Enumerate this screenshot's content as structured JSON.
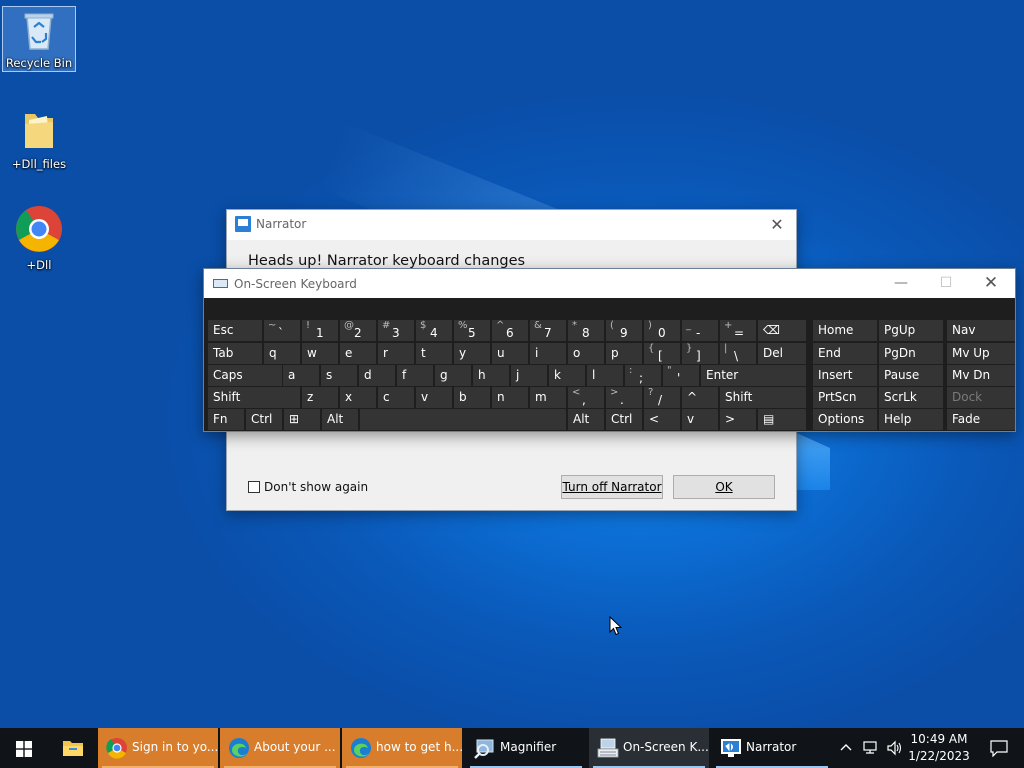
{
  "desktop": {
    "icons": [
      {
        "label": "Recycle Bin"
      },
      {
        "label": "+Dll_files"
      },
      {
        "label": "+Dll"
      }
    ]
  },
  "narrator": {
    "title": "Narrator",
    "close_glyph": "✕",
    "heading": "Heads up! Narrator keyboard changes",
    "checkbox_label": "Don't show again",
    "turn_off_label": "Turn off Narrator",
    "ok_label": "OK"
  },
  "osk": {
    "title": "On-Screen Keyboard",
    "minimize_glyph": "—",
    "maximize_glyph": "☐",
    "close_glyph": "✕",
    "rows": [
      [
        {
          "m": "Esc"
        },
        {
          "s": "~",
          "b": "`"
        },
        {
          "s": "!",
          "b": "1"
        },
        {
          "s": "@",
          "b": "2"
        },
        {
          "s": "#",
          "b": "3"
        },
        {
          "s": "$",
          "b": "4"
        },
        {
          "s": "%",
          "b": "5"
        },
        {
          "s": "^",
          "b": "6"
        },
        {
          "s": "&",
          "b": "7"
        },
        {
          "s": "*",
          "b": "8"
        },
        {
          "s": "(",
          "b": "9"
        },
        {
          "s": ")",
          "b": "0"
        },
        {
          "s": "_",
          "b": "-"
        },
        {
          "s": "+",
          "b": "="
        },
        {
          "m": "⌫"
        }
      ],
      [
        {
          "m": "Tab"
        },
        {
          "m": "q"
        },
        {
          "m": "w"
        },
        {
          "m": "e"
        },
        {
          "m": "r"
        },
        {
          "m": "t"
        },
        {
          "m": "y"
        },
        {
          "m": "u"
        },
        {
          "m": "i"
        },
        {
          "m": "o"
        },
        {
          "m": "p"
        },
        {
          "s": "{",
          "b": "["
        },
        {
          "s": "}",
          "b": "]"
        },
        {
          "s": "|",
          "b": "\\"
        },
        {
          "m": "Del"
        }
      ],
      [
        {
          "m": "Caps"
        },
        {
          "m": "a"
        },
        {
          "m": "s"
        },
        {
          "m": "d"
        },
        {
          "m": "f"
        },
        {
          "m": "g"
        },
        {
          "m": "h"
        },
        {
          "m": "j"
        },
        {
          "m": "k"
        },
        {
          "m": "l"
        },
        {
          "s": ":",
          "b": ";"
        },
        {
          "s": "\"",
          "b": "'"
        },
        {
          "m": "Enter"
        }
      ],
      [
        {
          "m": "Shift"
        },
        {
          "m": "z"
        },
        {
          "m": "x"
        },
        {
          "m": "c"
        },
        {
          "m": "v"
        },
        {
          "m": "b"
        },
        {
          "m": "n"
        },
        {
          "m": "m"
        },
        {
          "s": "<",
          "b": ","
        },
        {
          "s": ">",
          "b": "."
        },
        {
          "s": "?",
          "b": "/"
        },
        {
          "m": "^"
        },
        {
          "m": "Shift"
        }
      ],
      [
        {
          "m": "Fn"
        },
        {
          "m": "Ctrl"
        },
        {
          "m": "⊞"
        },
        {
          "m": "Alt"
        },
        {
          "m": ""
        },
        {
          "m": "Alt"
        },
        {
          "m": "Ctrl"
        },
        {
          "m": "<"
        },
        {
          "m": "v"
        },
        {
          "m": ">"
        },
        {
          "m": "▤"
        }
      ]
    ],
    "nav_rows": [
      [
        "Home",
        "PgUp",
        "Nav"
      ],
      [
        "End",
        "PgDn",
        "Mv Up"
      ],
      [
        "Insert",
        "Pause",
        "Mv Dn"
      ],
      [
        "PrtScn",
        "ScrLk",
        "Dock"
      ],
      [
        "Options",
        "Help",
        "Fade"
      ]
    ]
  },
  "taskbar": {
    "items": [
      {
        "label": "Sign in to yo...",
        "icon": "chrome-icon"
      },
      {
        "label": "About your ...",
        "icon": "edge-icon"
      },
      {
        "label": "how to get h...",
        "icon": "edge-icon"
      },
      {
        "label": "Magnifier",
        "icon": "magnifier-icon"
      },
      {
        "label": "On-Screen K...",
        "icon": "keyboard-icon"
      },
      {
        "label": "Narrator",
        "icon": "narrator-icon"
      }
    ],
    "time": "10:49 AM",
    "date": "1/22/2023"
  }
}
